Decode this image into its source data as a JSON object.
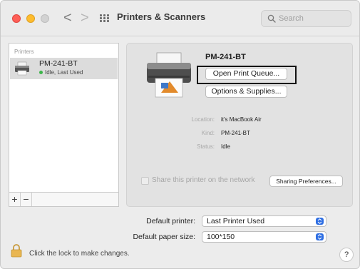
{
  "window": {
    "title": "Printers & Scanners"
  },
  "toolbar": {
    "back_glyph": "<",
    "forward_glyph": ">"
  },
  "search": {
    "placeholder": "Search"
  },
  "sidebar": {
    "header": "Printers",
    "items": [
      {
        "name": "PM-241-BT",
        "status": "Idle, Last Used"
      }
    ],
    "add_label": "+",
    "remove_label": "−"
  },
  "detail": {
    "printer_name": "PM-241-BT",
    "open_queue_label": "Open Print Queue...",
    "options_label": "Options & Supplies...",
    "location_label": "Location:",
    "location_value": "it's MacBook Air",
    "kind_label": "Kind:",
    "kind_value": "PM-241-BT",
    "status_label": "Status:",
    "status_value": "Idle",
    "share_label": "Share this printer on the network",
    "sharing_prefs_label": "Sharing Preferences..."
  },
  "defaults": {
    "printer_label": "Default printer:",
    "printer_value": "Last Printer Used",
    "paper_label": "Default paper size:",
    "paper_value": "100*150"
  },
  "footer": {
    "lock_text": "Click the lock to make changes.",
    "help_label": "?"
  },
  "colors": {
    "accent": "#2f6fe3",
    "status_idle": "#3cb54a"
  }
}
